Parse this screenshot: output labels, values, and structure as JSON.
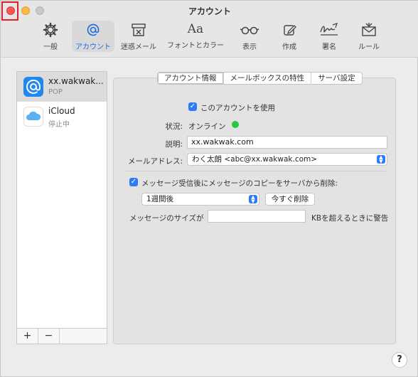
{
  "window": {
    "title": "アカウント"
  },
  "toolbar": [
    {
      "label": "一般",
      "icon": "gear-icon"
    },
    {
      "label": "アカウント",
      "icon": "at-icon",
      "active": true
    },
    {
      "label": "迷惑メール",
      "icon": "junk-icon"
    },
    {
      "label": "フォントとカラー",
      "icon": "font-icon"
    },
    {
      "label": "表示",
      "icon": "glasses-icon"
    },
    {
      "label": "作成",
      "icon": "compose-icon"
    },
    {
      "label": "署名",
      "icon": "signature-icon"
    },
    {
      "label": "ルール",
      "icon": "rules-icon"
    }
  ],
  "toolbar_font_glyph": "Aa",
  "accounts": [
    {
      "name": "xx.wakwak...",
      "type": "POP",
      "selected": true
    },
    {
      "name": "iCloud",
      "type": "停止中",
      "selected": false
    }
  ],
  "sidebar_footer": {
    "add": "+",
    "remove": "−"
  },
  "tabs": [
    {
      "label": "アカウント情報",
      "active": true
    },
    {
      "label": "メールボックスの特性",
      "active": false
    },
    {
      "label": "サーバ設定",
      "active": false
    }
  ],
  "form": {
    "enable_account_label": "このアカウントを使用",
    "enable_account_checked": true,
    "status_label": "状況:",
    "status_value": "オンライン",
    "description_label": "説明:",
    "description_value": "xx.wakwak.com",
    "email_label": "メールアドレス:",
    "email_value": "わく太朗 <abc@xx.wakwak.com>",
    "remove_copy_label": "メッセージ受信後にメッセージのコピーをサーバから削除:",
    "remove_copy_checked": true,
    "remove_after_value": "1週間後",
    "remove_now_button": "今すぐ削除",
    "size_label": "メッセージのサイズが",
    "size_value": "",
    "size_suffix": "KBを超えるときに警告"
  },
  "help": "?",
  "colors": {
    "accent": "#2f7bf5",
    "online": "#28c840",
    "close": "#fc5753",
    "minimize": "#fdbc40",
    "highlight": "#e0202a"
  }
}
